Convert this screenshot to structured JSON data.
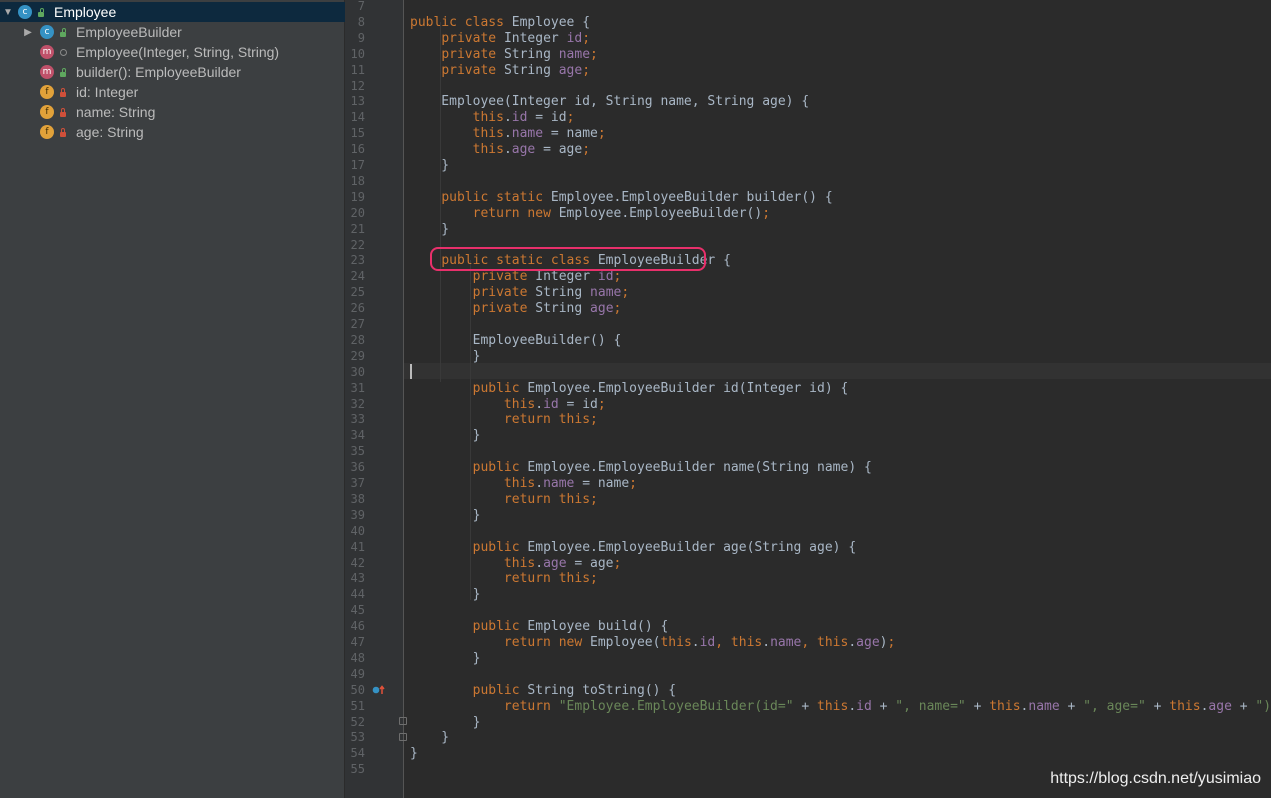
{
  "structure": {
    "items": [
      {
        "label": "Employee",
        "badge": "c",
        "visibility": "public",
        "expanded": true,
        "selected": true
      },
      {
        "label": "EmployeeBuilder",
        "badge": "c",
        "visibility": "public",
        "expanded": false
      },
      {
        "label": "Employee(Integer, String, String)",
        "badge": "m",
        "visibility": "package"
      },
      {
        "label": "builder(): EmployeeBuilder",
        "badge": "m",
        "visibility": "public"
      },
      {
        "label": "id: Integer",
        "badge": "f",
        "visibility": "private"
      },
      {
        "label": "name: String",
        "badge": "f",
        "visibility": "private"
      },
      {
        "label": "age: String",
        "badge": "f",
        "visibility": "private"
      }
    ]
  },
  "editor": {
    "line_numbers": [
      "7",
      "8",
      "9",
      "10",
      "11",
      "12",
      "13",
      "14",
      "15",
      "16",
      "17",
      "18",
      "19",
      "20",
      "21",
      "22",
      "23",
      "24",
      "25",
      "26",
      "27",
      "28",
      "29",
      "30",
      "31",
      "32",
      "33",
      "34",
      "35",
      "36",
      "37",
      "38",
      "39",
      "40",
      "41",
      "42",
      "43",
      "44",
      "45",
      "46",
      "47",
      "48",
      "49",
      "50",
      "51",
      "52",
      "53",
      "54",
      "55"
    ],
    "lines": [
      [],
      [
        [
          "kw",
          "public class "
        ],
        [
          "t",
          "Employee {"
        ]
      ],
      [
        [
          "t",
          "    "
        ],
        [
          "kw",
          "private "
        ],
        [
          "t",
          "Integer "
        ],
        [
          "fld",
          "id"
        ],
        [
          "kw",
          ";"
        ]
      ],
      [
        [
          "t",
          "    "
        ],
        [
          "kw",
          "private "
        ],
        [
          "t",
          "String "
        ],
        [
          "fld",
          "name"
        ],
        [
          "kw",
          ";"
        ]
      ],
      [
        [
          "t",
          "    "
        ],
        [
          "kw",
          "private "
        ],
        [
          "t",
          "String "
        ],
        [
          "fld",
          "age"
        ],
        [
          "kw",
          ";"
        ]
      ],
      [],
      [
        [
          "t",
          "    Employee(Integer id, String name, String age) {"
        ]
      ],
      [
        [
          "t",
          "        "
        ],
        [
          "kw",
          "this"
        ],
        [
          "t",
          "."
        ],
        [
          "fld",
          "id"
        ],
        [
          "t",
          " = id"
        ],
        [
          "kw",
          ";"
        ]
      ],
      [
        [
          "t",
          "        "
        ],
        [
          "kw",
          "this"
        ],
        [
          "t",
          "."
        ],
        [
          "fld",
          "name"
        ],
        [
          "t",
          " = name"
        ],
        [
          "kw",
          ";"
        ]
      ],
      [
        [
          "t",
          "        "
        ],
        [
          "kw",
          "this"
        ],
        [
          "t",
          "."
        ],
        [
          "fld",
          "age"
        ],
        [
          "t",
          " = age"
        ],
        [
          "kw",
          ";"
        ]
      ],
      [
        [
          "t",
          "    }"
        ]
      ],
      [],
      [
        [
          "t",
          "    "
        ],
        [
          "kw",
          "public static "
        ],
        [
          "t",
          "Employee.EmployeeBuilder builder() {"
        ]
      ],
      [
        [
          "t",
          "        "
        ],
        [
          "kw",
          "return new "
        ],
        [
          "t",
          "Employee.EmployeeBuilder()"
        ],
        [
          "kw",
          ";"
        ]
      ],
      [
        [
          "t",
          "    }"
        ]
      ],
      [],
      [
        [
          "t",
          "    "
        ],
        [
          "kw",
          "public static class "
        ],
        [
          "t",
          "EmployeeBuilder {"
        ]
      ],
      [
        [
          "t",
          "        "
        ],
        [
          "kw",
          "private "
        ],
        [
          "t",
          "Integer "
        ],
        [
          "fld",
          "id"
        ],
        [
          "kw",
          ";"
        ]
      ],
      [
        [
          "t",
          "        "
        ],
        [
          "kw",
          "private "
        ],
        [
          "t",
          "String "
        ],
        [
          "fld",
          "name"
        ],
        [
          "kw",
          ";"
        ]
      ],
      [
        [
          "t",
          "        "
        ],
        [
          "kw",
          "private "
        ],
        [
          "t",
          "String "
        ],
        [
          "fld",
          "age"
        ],
        [
          "kw",
          ";"
        ]
      ],
      [],
      [
        [
          "t",
          "        EmployeeBuilder() {"
        ]
      ],
      [
        [
          "t",
          "        }"
        ]
      ],
      [],
      [
        [
          "t",
          "        "
        ],
        [
          "kw",
          "public "
        ],
        [
          "t",
          "Employee.EmployeeBuilder id(Integer id) {"
        ]
      ],
      [
        [
          "t",
          "            "
        ],
        [
          "kw",
          "this"
        ],
        [
          "t",
          "."
        ],
        [
          "fld",
          "id"
        ],
        [
          "t",
          " = id"
        ],
        [
          "kw",
          ";"
        ]
      ],
      [
        [
          "t",
          "            "
        ],
        [
          "kw",
          "return this;"
        ]
      ],
      [
        [
          "t",
          "        }"
        ]
      ],
      [],
      [
        [
          "t",
          "        "
        ],
        [
          "kw",
          "public "
        ],
        [
          "t",
          "Employee.EmployeeBuilder name(String name) {"
        ]
      ],
      [
        [
          "t",
          "            "
        ],
        [
          "kw",
          "this"
        ],
        [
          "t",
          "."
        ],
        [
          "fld",
          "name"
        ],
        [
          "t",
          " = name"
        ],
        [
          "kw",
          ";"
        ]
      ],
      [
        [
          "t",
          "            "
        ],
        [
          "kw",
          "return this;"
        ]
      ],
      [
        [
          "t",
          "        }"
        ]
      ],
      [],
      [
        [
          "t",
          "        "
        ],
        [
          "kw",
          "public "
        ],
        [
          "t",
          "Employee.EmployeeBuilder age(String age) {"
        ]
      ],
      [
        [
          "t",
          "            "
        ],
        [
          "kw",
          "this"
        ],
        [
          "t",
          "."
        ],
        [
          "fld",
          "age"
        ],
        [
          "t",
          " = age"
        ],
        [
          "kw",
          ";"
        ]
      ],
      [
        [
          "t",
          "            "
        ],
        [
          "kw",
          "return this;"
        ]
      ],
      [
        [
          "t",
          "        }"
        ]
      ],
      [],
      [
        [
          "t",
          "        "
        ],
        [
          "kw",
          "public "
        ],
        [
          "t",
          "Employee build() {"
        ]
      ],
      [
        [
          "t",
          "            "
        ],
        [
          "kw",
          "return new "
        ],
        [
          "t",
          "Employee("
        ],
        [
          "kw",
          "this"
        ],
        [
          "t",
          "."
        ],
        [
          "fld",
          "id"
        ],
        [
          "kw",
          ", this"
        ],
        [
          "t",
          "."
        ],
        [
          "fld",
          "name"
        ],
        [
          "kw",
          ", this"
        ],
        [
          "t",
          "."
        ],
        [
          "fld",
          "age"
        ],
        [
          "t",
          ")"
        ],
        [
          "kw",
          ";"
        ]
      ],
      [
        [
          "t",
          "        }"
        ]
      ],
      [],
      [
        [
          "t",
          "        "
        ],
        [
          "kw",
          "public "
        ],
        [
          "t",
          "String toString() {"
        ]
      ],
      [
        [
          "t",
          "            "
        ],
        [
          "kw",
          "return "
        ],
        [
          "str",
          "\"Employee.EmployeeBuilder(id=\""
        ],
        [
          "t",
          " + "
        ],
        [
          "kw",
          "this"
        ],
        [
          "t",
          "."
        ],
        [
          "fld",
          "id"
        ],
        [
          "t",
          " + "
        ],
        [
          "str",
          "\", name=\""
        ],
        [
          "t",
          " + "
        ],
        [
          "kw",
          "this"
        ],
        [
          "t",
          "."
        ],
        [
          "fld",
          "name"
        ],
        [
          "t",
          " + "
        ],
        [
          "str",
          "\", age=\""
        ],
        [
          "t",
          " + "
        ],
        [
          "kw",
          "this"
        ],
        [
          "t",
          "."
        ],
        [
          "fld",
          "age"
        ],
        [
          "t",
          " + "
        ],
        [
          "str",
          "\")\""
        ],
        [
          "kw",
          ";"
        ]
      ],
      [
        [
          "t",
          "        }"
        ]
      ],
      [
        [
          "t",
          "    }"
        ]
      ],
      [
        [
          "t",
          "}"
        ]
      ],
      []
    ]
  },
  "watermark": "https://blog.csdn.net/yusimiao",
  "colors": {
    "keyword": "#cc7832",
    "string": "#6a8759",
    "field": "#9876aa",
    "text": "#a9b7c6",
    "highlight": "#e8306b"
  }
}
